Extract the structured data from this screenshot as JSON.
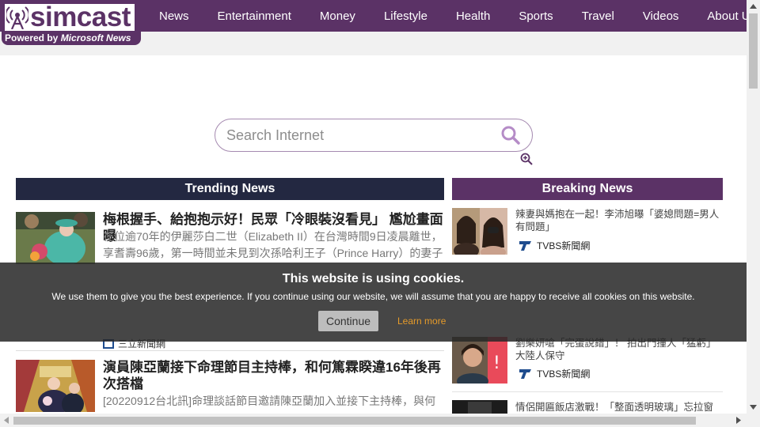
{
  "brand": {
    "name": "simcast",
    "powered_prefix": "Powered by ",
    "powered_brand": "Microsoft News"
  },
  "nav": {
    "items": [
      "News",
      "Entertainment",
      "Money",
      "Lifestyle",
      "Health",
      "Sports",
      "Travel",
      "Videos",
      "About Us"
    ]
  },
  "search": {
    "placeholder": "Search Internet"
  },
  "trending": {
    "header": "Trending News",
    "items": [
      {
        "title": "梅根握手、給抱抱示好！民眾「冷眼裝沒看見」 尷尬畫面曝",
        "desc": "在位逾70年的伊麗莎白二世（Elizabeth II）在台灣時間9日凌晨離世，享耆壽96歲，第一時間並未見到次孫哈利王子（Prince Harry）的妻子",
        "source": "三立新聞網"
      },
      {
        "title": "演員陳亞蘭接下命理節目主持棒，和何篤霖睽違16年後再次搭檔",
        "desc": "[20220912台北訊]命理談話節目邀請陳亞蘭加入並接下主持棒，與何"
      }
    ]
  },
  "breaking": {
    "header": "Breaking News",
    "items": [
      {
        "title": "辣妻與媽抱在一起！李沛旭曝「婆媳問題=男人有問題」",
        "source": "TVBS新聞網"
      },
      {
        "title": "劉樂妍嗆「完蛋說錯」！ 拍出門撞人「猛虧」大陸人保守",
        "source": "TVBS新聞網"
      },
      {
        "title": "情侶開匾飯店激戰！「整面透明玻璃」忘拉窗簾"
      }
    ]
  },
  "cookie": {
    "title": "This website is using cookies.",
    "text": "We use them to give you the best experience. If you continue using our website, we will assume that you are happy to receive all cookies on this website.",
    "continue_label": "Continue",
    "learn_more_label": "Learn more"
  },
  "colors": {
    "brand_purple": "#5b3266",
    "trending_navy": "#232841",
    "learn_more_orange": "#e69b2a"
  }
}
